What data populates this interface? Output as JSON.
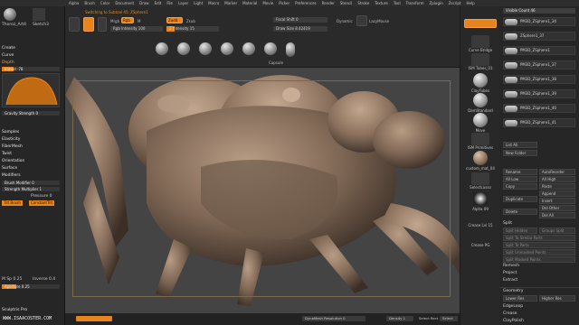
{
  "menubar": {
    "items": [
      "Alpha",
      "Brush",
      "Color",
      "Document",
      "Draw",
      "Edit",
      "File",
      "Layer",
      "Light",
      "Macro",
      "Marker",
      "Material",
      "Movie",
      "Picker",
      "Preferences",
      "Render",
      "Stencil",
      "Stroke",
      "Texture",
      "Tool",
      "Transform",
      "Zplugin",
      "Zscript",
      "Help"
    ]
  },
  "shelf": {
    "switch_label": "Switching to Subtool 45: ZSphere1",
    "edit_label": "Edit",
    "draw_label": "Draw",
    "mrgb_label": "Mrgb",
    "rgb_label": "Rgb",
    "m_label": "M",
    "zadd_label": "Zadd",
    "zsub_label": "Zsub",
    "rgb_intensity": "Rgb Intensity 100",
    "z_intensity": "Z Intensity 15",
    "focal_shift": "Focal Shift 0",
    "draw_size": "Draw Size 8.42419",
    "dynamic_label": "Dynamic",
    "lazymouse_label": "LazyMouse",
    "brush_names": [
      "Smooth",
      "Move",
      "ClayBuildup",
      "Standard",
      "DamStandard",
      "hPolish",
      "Capsule"
    ],
    "live_boolean": "Live Boolean",
    "texture_off": "Texture Off"
  },
  "leftpanel": {
    "tool_icons": [
      "Fresh Saved",
      "Subdivider",
      "Thoroz_Art4",
      "Sketch3"
    ],
    "create": "Create",
    "curve": "Curve",
    "depth": "Depth",
    "imbed": "Imbed -78",
    "gravity": "Gravity Strength 0",
    "samples": "Samples",
    "elasticity": "Elasticity",
    "fibermesh": "FiberMesh",
    "twist": "Twist",
    "orientation": "Orientation",
    "surface": "Surface",
    "modifiers": "Modifiers",
    "brush_modifier": "Brush Modifier 0",
    "strength_multiplier": "Strength Multiplier 1",
    "pressure": "Pressure 0",
    "tilt_brush": "Tilt Brush",
    "constant_tilt": "ConstantTilt",
    "m_sp": "M Sp 0.25",
    "inverse": "Inverse 0.4",
    "aperture": "Aperture 0.25",
    "sculptris_pro": "Sculptris Pro"
  },
  "rightstrip": {
    "items": [
      "Curve Bridge",
      "ISM Tubes_01",
      "ClayTubes",
      "DamStandard",
      "Move",
      "ISM Primitives",
      "custom_mat_04",
      "SelectLasso",
      "Alpha 09",
      "Crease Lvl 15",
      "Crease PG"
    ],
    "fill_label": "Fill"
  },
  "rightpanel": {
    "visible_count": "Visible Count 46",
    "subtools": [
      "PM3D_ZSphere1_34",
      "ZSphere1_37",
      "PM3D_ZSphere1",
      "PM3D_ZSphere1_37",
      "PM3D_ZSphere1_38",
      "PM3D_ZSphere1_39",
      "PM3D_ZSphere1_40",
      "PM3D_ZSphere1_41"
    ],
    "list_all": "List All",
    "new_folder": "New Folder",
    "rename": "Rename",
    "autoreorder": "AutoReorder",
    "all_low": "All Low",
    "all_high": "All High",
    "copy": "Copy",
    "paste": "Paste",
    "append": "Append",
    "duplicate": "Duplicate",
    "insert": "Insert",
    "delete": "Delete",
    "del_other": "Del Other",
    "del_all": "Del All",
    "split": "Split",
    "split_hidden": "Split Hidden",
    "groups_split": "Groups Split",
    "split_to_similar": "Split To Similar Parts",
    "split_to_parts": "Split To Parts",
    "split_unmasked": "Split Unmasked Points",
    "split_masked": "Split Masked Points",
    "remesh": "Remesh",
    "project": "Project",
    "extract": "Extract",
    "geometry": "Geometry",
    "lower_res": "Lower Res",
    "higher_res": "Higher Res",
    "edgeloop": "EdgeLoop",
    "crease": "Crease",
    "claypolish": "ClayPolish"
  },
  "bottombar": {
    "dynamesh_resolution": "DynaMesh Resolution 0",
    "density": "Density 1",
    "select_rect": "Select Rect",
    "select_lasso": "Select"
  },
  "watermark": "WWW.ISAACOSTER.COM",
  "colors": {
    "accent": "#e8841c",
    "model": "#8e7661",
    "canvas": "#444444"
  }
}
